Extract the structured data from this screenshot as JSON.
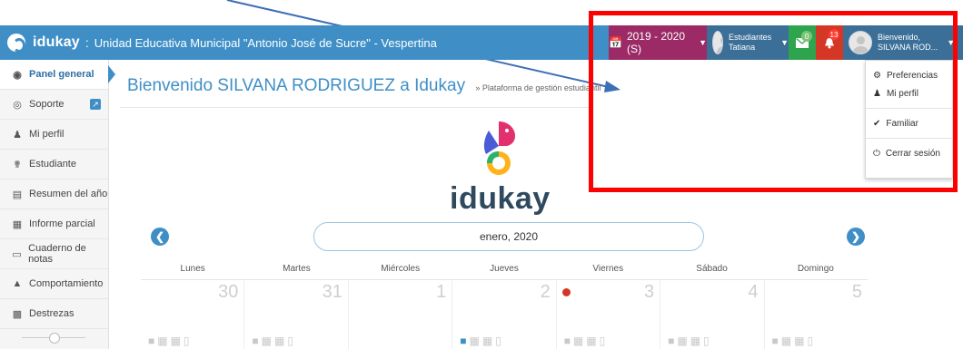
{
  "header": {
    "brand": "idukay",
    "separator": ":",
    "school": "Unidad Educativa Municipal \"Antonio José de Sucre\" - Vespertina",
    "year_selector": "2019 - 2020 (S)",
    "students_label": "Estudiantes",
    "student_name": "Tatiana",
    "messages_count": "0",
    "notifications_count": "13",
    "welcome_label": "Bienvenido,",
    "user_name": "SILVANA ROD..."
  },
  "dropdown": {
    "items": [
      {
        "label": "Preferencias",
        "icon": "gear-icon"
      },
      {
        "label": "Mi perfil",
        "icon": "user-icon"
      },
      {
        "label": "Familiar",
        "icon": "check-icon"
      },
      {
        "label": "Cerrar sesión",
        "icon": "power-icon"
      }
    ]
  },
  "sidebar": {
    "items": [
      {
        "label": "Panel general",
        "icon": "dashboard-icon"
      },
      {
        "label": "Soporte",
        "icon": "lifebuoy-icon"
      },
      {
        "label": "Mi perfil",
        "icon": "user-icon"
      },
      {
        "label": "Estudiante",
        "icon": "student-icon"
      },
      {
        "label": "Resumen del año",
        "icon": "bar-chart-icon"
      },
      {
        "label": "Informe parcial",
        "icon": "table-icon"
      },
      {
        "label": "Cuaderno de notas",
        "icon": "notebook-icon"
      },
      {
        "label": "Comportamiento",
        "icon": "thumbs-up-icon"
      },
      {
        "label": "Destrezas",
        "icon": "skills-icon"
      }
    ]
  },
  "main": {
    "title": "Bienvenido SILVANA RODRIGUEZ a Idukay",
    "subtitle": "» Plataforma de gestión estudiantil",
    "logo_text": "idukay"
  },
  "calendar": {
    "month": "enero, 2020",
    "weekdays": [
      "Lunes",
      "Martes",
      "Miércoles",
      "Jueves",
      "Viernes",
      "Sábado",
      "Domingo"
    ],
    "days": [
      "30",
      "31",
      "1",
      "2",
      "3",
      "4",
      "5"
    ]
  },
  "colors": {
    "primary": "#3f8fc6",
    "year": "#9c2a66",
    "messages": "#2ea44f",
    "alerts": "#d53727",
    "highlight": "#ff0000"
  }
}
